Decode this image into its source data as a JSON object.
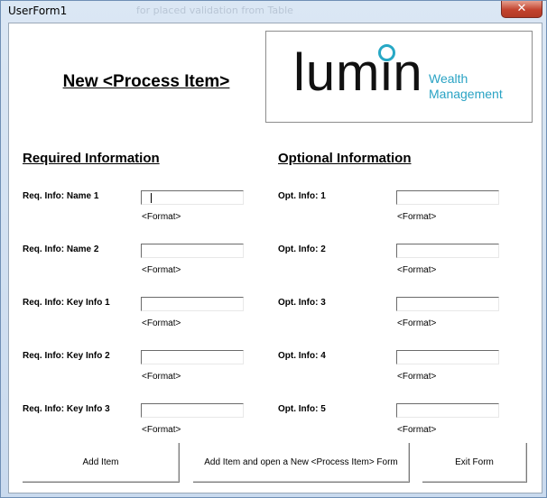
{
  "window": {
    "title": "UserForm1",
    "ghost_text": "for placed validation from Table"
  },
  "form": {
    "title": "New <Process Item>"
  },
  "logo": {
    "main": "lumin",
    "line1": "Wealth",
    "line2": "Management",
    "accent_color": "#27a8c5"
  },
  "required": {
    "heading": "Required Information",
    "fields": [
      {
        "label": "Req. Info: Name 1",
        "format": "<Format>",
        "value": ""
      },
      {
        "label": "Req. Info: Name 2",
        "format": "<Format>",
        "value": ""
      },
      {
        "label": "Req. Info: Key Info 1",
        "format": "<Format>",
        "value": ""
      },
      {
        "label": "Req. Info: Key Info 2",
        "format": "<Format>",
        "value": ""
      },
      {
        "label": "Req. Info: Key Info 3",
        "format": "<Format>",
        "value": ""
      }
    ]
  },
  "optional": {
    "heading": "Optional Information",
    "fields": [
      {
        "label": "Opt. Info: 1",
        "format": "<Format>",
        "value": ""
      },
      {
        "label": "Opt. Info: 2",
        "format": "<Format>",
        "value": ""
      },
      {
        "label": "Opt. Info: 3",
        "format": "<Format>",
        "value": ""
      },
      {
        "label": "Opt. Info: 4",
        "format": "<Format>",
        "value": ""
      },
      {
        "label": "Opt. Info: 5",
        "format": "<Format>",
        "value": ""
      }
    ]
  },
  "buttons": {
    "add_item": "Add Item",
    "add_and_new": "Add Item and open a New  <Process Item>  Form",
    "exit": "Exit Form"
  }
}
